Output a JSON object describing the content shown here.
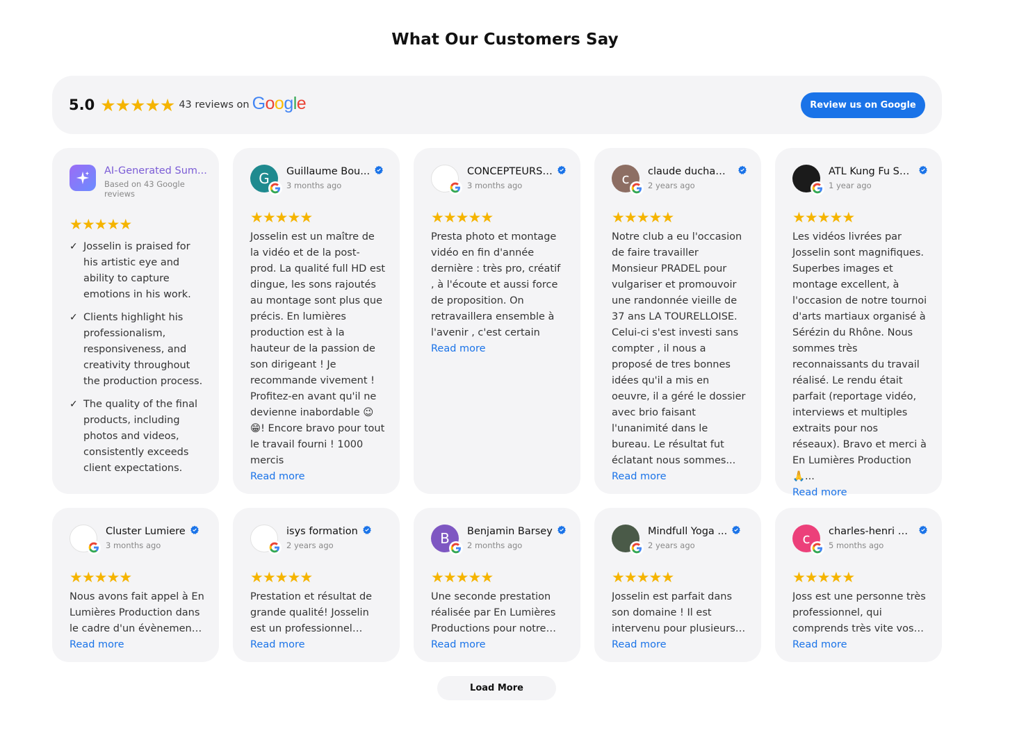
{
  "header": {
    "title": "What Our Customers Say"
  },
  "summary": {
    "rating": "5.0",
    "review_count_text": "43 reviews on",
    "google_wordmark": "Google",
    "review_button": "Review us on Google"
  },
  "ai_summary": {
    "title": "AI-Generated Sum...",
    "subtitle": "Based on 43 Google reviews",
    "points": [
      "Josselin is praised for his artistic eye and ability to capture emotions in his work.",
      "Clients highlight his professionalism, responsiveness, and creativity throughout the production process.",
      "The quality of the final products, including photos and videos, consistently exceeds client expectations."
    ]
  },
  "reviews": [
    {
      "name": "Guillaume Bou...",
      "time": "3 months ago",
      "avatar_letter": "G",
      "avatar_color": "#1f8a8f",
      "text": "Josselin est un maître de la vidéo et de la post-prod. La qualité full HD est dingue, les sons rajoutés au montage sont plus que précis. En lumières production est à la hauteur de la passion de son dirigeant ! Je recommande vivement ! Profitez-en avant qu'il ne devienne inabordable 😉 😁! Encore bravo pour tout le travail fourni ! 1000 mercis",
      "read_more": "Read more"
    },
    {
      "name": "CONCEPTEURS ...",
      "time": "3 months ago",
      "avatar_letter": "",
      "avatar_color": "#ffffff",
      "text": "Presta photo et montage vidéo en fin d'année dernière : très pro, créatif , à l'écoute et aussi force de proposition. On retravaillera ensemble à l'avenir , c'est certain",
      "read_more": "Read more"
    },
    {
      "name": "claude ducham...",
      "time": "2 years ago",
      "avatar_letter": "c",
      "avatar_color": "#8d6e63",
      "text": "Notre club a eu l'occasion de faire travailler Monsieur PRADEL pour vulgariser et promouvoir une randonnée vieille de 37 ans LA TOURELLOISE. Celui-ci s'est investi sans compter , il nous a proposé de tres bonnes idées qu'il a mis en oeuvre, il a géré le dossier avec brio faisant l'unanimité dans le bureau. Le résultat fut éclatant nous sommes...",
      "read_more": "Read more"
    },
    {
      "name": "ATL Kung Fu Sé...",
      "time": "1 year ago",
      "avatar_letter": "",
      "avatar_color": "#1b1b1b",
      "text": "Les vidéos livrées par Josselin sont magnifiques. Superbes images et montage excellent, à l'occasion de notre tournoi d'arts martiaux organisé à Sérézin du Rhône. Nous sommes très reconnaissants du travail réalisé. Le rendu était parfait (reportage vidéo, interviews et multiples extraits pour nos réseaux). Bravo et merci à En Lumières Production 🙏...",
      "read_more": "Read more"
    },
    {
      "name": "Cluster Lumiere",
      "time": "3 months ago",
      "avatar_letter": "",
      "avatar_color": "#ffffff",
      "text": "Nous avons fait appel à En Lumières Production dans le cadre d'un évènement organisé...",
      "read_more": "Read more"
    },
    {
      "name": "isys formation",
      "time": "2 years ago",
      "avatar_letter": "",
      "avatar_color": "#ffffff",
      "text": "Prestation et résultat de grande qualité! Josselin est un professionnel attentif...",
      "read_more": "Read more"
    },
    {
      "name": "Benjamin Barsey",
      "time": "2 months ago",
      "avatar_letter": "B",
      "avatar_color": "#7e57c2",
      "text": "Une seconde prestation réalisée par En Lumières Productions pour notre entreprise...",
      "read_more": "Read more"
    },
    {
      "name": "Mindfull Yoga ...",
      "time": "2 years ago",
      "avatar_letter": "",
      "avatar_color": "#4a5a48",
      "text": "Josselin est parfait dans son domaine ! Il est intervenu pour plusieurs vidéos...",
      "read_more": "Read more"
    },
    {
      "name": "charles-henri D...",
      "time": "5 months ago",
      "avatar_letter": "c",
      "avatar_color": "#ec407a",
      "text": "Joss est une personne très professionnel, qui comprends très vite vos attentes...",
      "read_more": "Read more"
    }
  ],
  "footer": {
    "load_more": "Load More"
  },
  "colors": {
    "star": "#f5b400",
    "accent": "#1a73e8",
    "card_bg": "#f4f4f6",
    "verified": "#1a73e8"
  }
}
